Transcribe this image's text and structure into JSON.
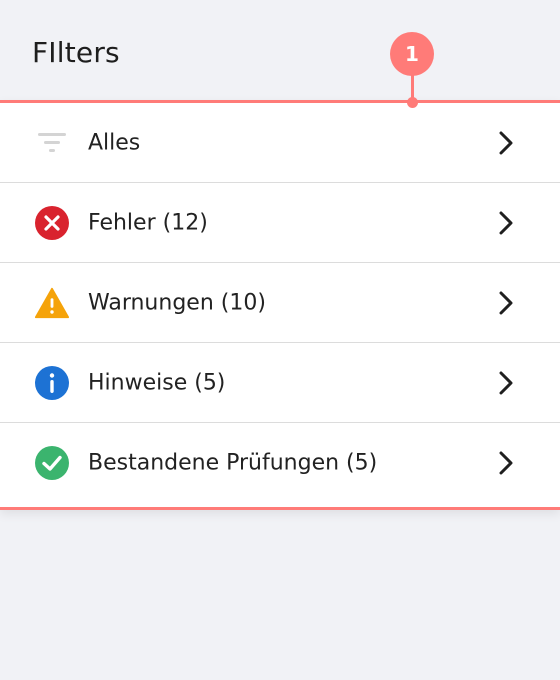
{
  "header": {
    "title": "FIlters"
  },
  "annotation": {
    "badge_number": "1",
    "color": "#ff7b78"
  },
  "filters": [
    {
      "label": "Alles",
      "icon": "filter-icon",
      "color": "#d0d0d0"
    },
    {
      "label": "Fehler (12)",
      "icon": "error-icon",
      "color": "#d9232e"
    },
    {
      "label": "Warnungen (10)",
      "icon": "warning-icon",
      "color": "#f5a30a"
    },
    {
      "label": "Hinweise (5)",
      "icon": "info-icon",
      "color": "#1d72d4"
    },
    {
      "label": "Bestandene Prüfungen (5)",
      "icon": "success-icon",
      "color": "#3bb46e"
    }
  ]
}
